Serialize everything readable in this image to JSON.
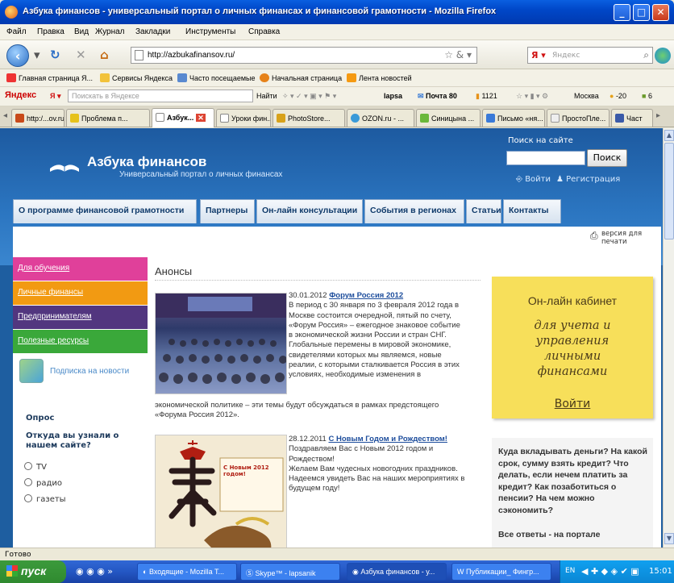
{
  "window": {
    "title": "Азбука финансов - универсальный портал о личных финансах и финансовой грамотности - Mozilla Firefox",
    "minimize": "_",
    "maximize": "□",
    "close": "✕"
  },
  "menu": [
    "Файл",
    "Правка",
    "Вид",
    "Журнал",
    "Закладки",
    "Инструменты",
    "Справка"
  ],
  "nav": {
    "url": "http://azbukafinansov.ru/",
    "search_placeholder": "Яндекс"
  },
  "bookmarks": [
    "Главная страница Я...",
    "Сервисы Яндекса",
    "Часто посещаемые",
    "Начальная страница",
    "Лента новостей"
  ],
  "yandex_bar": {
    "logo": "Яндекс",
    "search_placeholder": "Поискать в Яндексе",
    "find": "Найти",
    "user": "lapsa",
    "mail": "Почта 80",
    "count": "1121",
    "city": "Москва",
    "temp": "-20",
    "six": "6"
  },
  "tabs": [
    "http:/...ov.ru/",
    "Проблема п...",
    "Азбук...",
    "Уроки фин...",
    "PhotoStore...",
    "OZON.ru - ...",
    "Синицына ...",
    "Письмо «ня...",
    "ПростоПле...",
    "Част"
  ],
  "site": {
    "name": "Азбука финансов",
    "tagline": "Универсальный портал о личных финансах",
    "search_label": "Поиск на сайте",
    "search_button": "Поиск",
    "login": "Войти",
    "register": "Регистрация",
    "nav": [
      "О программе финансовой грамотности",
      "Партнеры",
      "Он-лайн консультации",
      "События в регионах",
      "Статьи",
      "Контакты"
    ],
    "print": "версия для печати",
    "left_menu": [
      "Для обучения",
      "Личные финансы",
      "Предпринимателям",
      "Полезные ресурсы"
    ],
    "left_menu_colors": [
      "#e0409a",
      "#f29a12",
      "#52367f",
      "#3aa83a"
    ],
    "subscribe": "Подписка на новости",
    "poll_title": "Опрос",
    "poll_question": "Откуда вы узнали о нашем сайте?",
    "poll_options": [
      "TV",
      "радио",
      "газеты"
    ],
    "announce_title": "Анонсы",
    "news": [
      {
        "date": "30.01.2012",
        "headline": "Форум Россия 2012",
        "lines": [
          "В период с 30 января по 3 февраля 2012 года в",
          "Москве состоится очередной, пятый по счету,",
          "«Форум Россия» – ежегодное знаковое событие",
          "в экономической жизни России и стран СНГ.",
          "Глобальные перемены в мировой экономике,",
          "свидетелями которых мы являемся, новые",
          "реалии, с которыми сталкивается Россия в этих",
          "условиях, необходимые изменения в"
        ],
        "tail": [
          "экономической политике – эти темы будут обсуждаться в рамках предстоящего",
          "«Форума Россия 2012»."
        ]
      },
      {
        "date": "28.12.2011",
        "headline": "С Новым Годом и Рождеством!",
        "lines": [
          "Поздравляем Вас с Новым 2012 годом и",
          "Рождеством!",
          "Желаем Вам чудесных новогодних праздников.",
          "Надеемся увидеть Вас на наших мероприятиях в",
          "будущем году!"
        ],
        "img_caption": "С Новым 2012 годом!"
      }
    ],
    "cabinet_title": "Он-лайн кабинет",
    "cabinet_script": [
      "для учета и",
      "управления",
      "личными",
      "финансами"
    ],
    "cabinet_login": "Войти",
    "ad_text": "Куда вкладывать деньги? На какой срок, сумму взять кредит? Что делать, если нечем платить за кредит? Как позаботиться о пенсии? На чем можно сэкономить?",
    "ad_bottom": "Все ответы - на портале"
  },
  "status": "Готово",
  "taskbar": {
    "start": "пуск",
    "items": [
      "Входящие - Mozilla T...",
      "Skype™ - lapsanik",
      "Азбука финансов - у...",
      "Публикации_ Фингр..."
    ],
    "lang": "EN",
    "clock": "15:01"
  }
}
